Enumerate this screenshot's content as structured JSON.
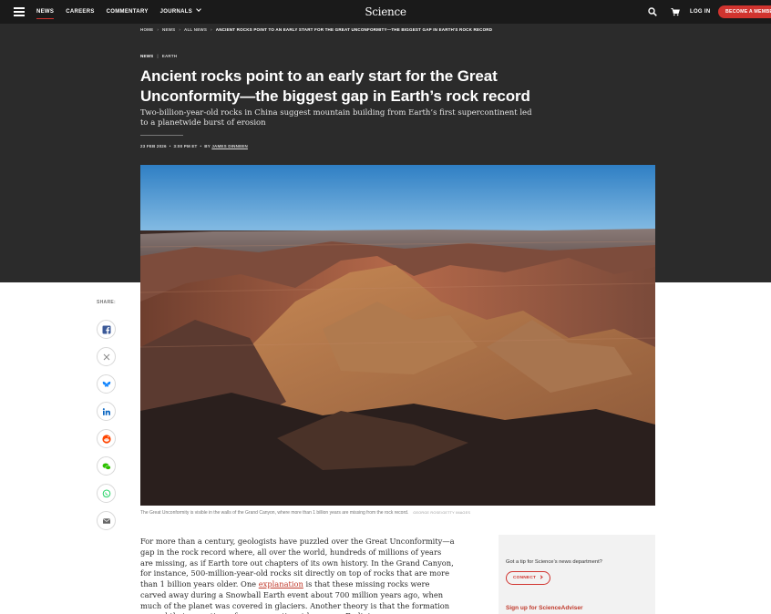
{
  "nav": {
    "links": [
      {
        "label": "NEWS",
        "active": true
      },
      {
        "label": "CAREERS",
        "active": false
      },
      {
        "label": "COMMENTARY",
        "active": false
      },
      {
        "label": "JOURNALS",
        "active": false
      }
    ],
    "logo": "Science",
    "login_label": "LOG IN",
    "become_member_label": "BECOME A MEMBER",
    "accent_color": "#d1342f"
  },
  "breadcrumb": [
    "HOME",
    "NEWS",
    "ALL NEWS",
    "ANCIENT ROCKS POINT TO AN EARLY START FOR THE GREAT UNCONFORMITY—THE BIGGEST GAP IN EARTH'S ROCK RECORD"
  ],
  "article": {
    "section": "NEWS",
    "subsection": "EARTH",
    "headline": "Ancient rocks point to an early start for the Great Unconformity—the biggest gap in Earth’s rock record",
    "dek": "Two-billion-year-old rocks in China suggest mountain building from Earth’s first supercontinent led to a planetwide burst of erosion",
    "date": "23 FEB 2026",
    "time": "3:00 PM ET",
    "by": "BY",
    "author": "JAMES DINNEEN",
    "image_caption": "The Great Unconformity is visible in the walls of the Grand Canyon, where more than 1 billion years are missing from the rock record.",
    "image_credit": "GEORGE ROSE/GETTY IMAGES",
    "body_part1": "For more than a century, geologists have puzzled over the Great Unconformity—a gap in the rock record where, all over the world, hundreds of millions of years are missing, as if Earth tore out chapters of its own history. In the Grand Canyon, for instance, 500-million-year-old rocks sit directly on top of rocks that are more than 1 billion years older. One",
    "body_link": "explanation",
    "body_part2": "is that these missing rocks were carved away during a Snowball Earth event about 700 million years ago, when much of the planet was covered in glaciers. Another theory is that the formation around that same time of a supercontinent known as Rodinia"
  },
  "share": {
    "label": "SHARE:",
    "buttons": [
      "facebook-icon",
      "x-icon",
      "bluesky-icon",
      "linkedin-icon",
      "reddit-icon",
      "wechat-icon",
      "whatsapp-icon",
      "email-icon"
    ]
  },
  "sidebar": {
    "tip_text": "Got a tip for Science’s news department?",
    "connect_label": "CONNECT",
    "signup_text": "Sign up for ScienceAdviser"
  }
}
